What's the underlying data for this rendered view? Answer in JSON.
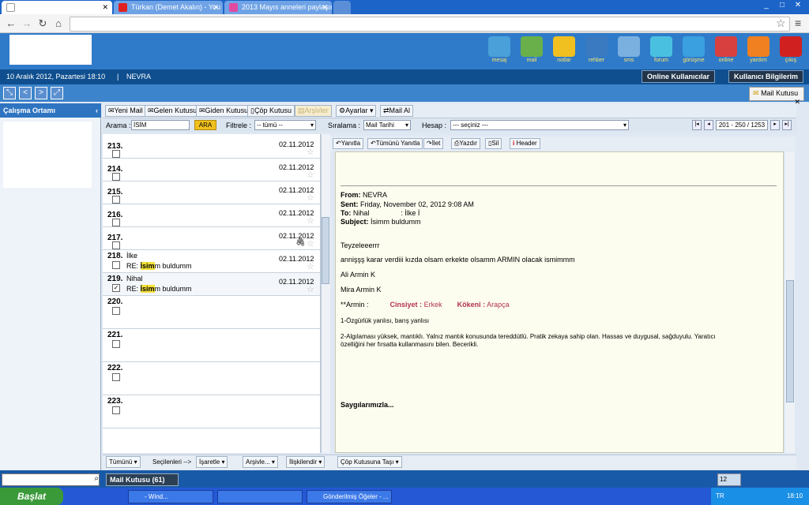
{
  "browser": {
    "tabs": [
      {
        "label": ""
      },
      {
        "label": "Türkan (Demet Akalın) - You"
      },
      {
        "label": "2013 Mayıs anneleri paylaşım"
      }
    ],
    "url": "",
    "window_controls": [
      "_",
      "□",
      "✕"
    ]
  },
  "app": {
    "icons": [
      {
        "label": "mesaj",
        "color": "#4aa0d8"
      },
      {
        "label": "mail",
        "color": "#6ab04a"
      },
      {
        "label": "notlar",
        "color": "#f0c020"
      },
      {
        "label": "rehber",
        "color": "#3a7ac0"
      },
      {
        "label": "sms",
        "color": "#7ab0e0"
      },
      {
        "label": "forum",
        "color": "#4ac0e0"
      },
      {
        "label": "görüşme",
        "color": "#3aa0e0"
      },
      {
        "label": "online",
        "color": "#d84040"
      },
      {
        "label": "yardım",
        "color": "#f08020"
      },
      {
        "label": "çıkış",
        "color": "#d02020"
      }
    ],
    "date": "10 Aralık 2012, Pazartesi 18:10",
    "user": "NEVRA",
    "online_users_btn": "Online Kullanıcılar",
    "user_info_btn": "Kullanıcı Bilgilerim",
    "mailbox_tab": "Mail Kutusu",
    "left_panel_title": "Çalışma Ortamı"
  },
  "mail_toolbar": {
    "new_mail": "Yeni Mail",
    "inbox": "Gelen Kutusu",
    "outbox": "Giden Kutusu",
    "trash": "Çöp Kutusu",
    "archive": "Arşivler",
    "settings": "Ayarlar",
    "fetch": "Mail Al"
  },
  "filters": {
    "search_label": "Arama :",
    "search_value": "İSİM",
    "search_btn": "ARA",
    "filter_label": "Filtrele :",
    "filter_value": "-- tümü --",
    "sort_label": "Sıralama :",
    "sort_value": "Mail Tarihi",
    "account_label": "Hesap :",
    "account_value": "--- seçiniz ---",
    "page_info": "201 - 250 / 1253"
  },
  "mails": [
    {
      "num": "213.",
      "date": "02.11.2012",
      "sender": "",
      "subject": "",
      "checked": false
    },
    {
      "num": "214.",
      "date": "02.11.2012",
      "sender": "",
      "subject": "",
      "checked": false
    },
    {
      "num": "215.",
      "date": "02.11.2012",
      "sender": "",
      "subject": "",
      "checked": false
    },
    {
      "num": "216.",
      "date": "02.11.2012",
      "sender": "",
      "subject": "",
      "checked": false
    },
    {
      "num": "217.",
      "date": "02.11.2012",
      "sender": "",
      "subject": "",
      "checked": false
    },
    {
      "num": "218.",
      "date": "02.11.2012",
      "sender": "İlke",
      "subject_pre": "RE: ",
      "subject_hl": "İsim",
      "subject_post": "m buldumm",
      "checked": false
    },
    {
      "num": "219.",
      "date": "02.11.2012",
      "sender": "Nihal",
      "subject_pre": "RE: ",
      "subject_hl": "İsim",
      "subject_post": "m buldumm",
      "checked": true
    },
    {
      "num": "220.",
      "date": "",
      "sender": "",
      "subject": "",
      "checked": false
    },
    {
      "num": "221.",
      "date": "",
      "sender": "",
      "subject": "",
      "checked": false
    },
    {
      "num": "222.",
      "date": "",
      "sender": "",
      "subject": "",
      "checked": false
    },
    {
      "num": "223.",
      "date": "",
      "sender": "",
      "subject": "",
      "checked": false
    }
  ],
  "read_toolbar": {
    "reply": "Yanıtla",
    "reply_all": "Tümünü Yanıtla",
    "forward": "İlet",
    "print": "Yazdır",
    "delete": "Sil",
    "header": "Header"
  },
  "message": {
    "from_label": "From:",
    "from": "NEVRA",
    "sent_label": "Sent:",
    "sent": "Friday, November 02, 2012 9:08 AM",
    "to_label": "To:",
    "to": "Nihal",
    "to_cc": ": İlke İ",
    "subject_label": "Subject:",
    "subject": "İsimm buldumm",
    "line1": "Teyzeleeerrr",
    "line2": "annişşş karar verdiii kızda olsam erkekte olsamm ARMIN olacak ismimmm",
    "line3": "Ali Armin K",
    "line4": "Mira Armin K",
    "armin_label": "**Armin :",
    "gender_label": "Cinsiyet :",
    "gender_value": "Erkek",
    "origin_label": "Kökeni :",
    "origin_value": "Arapça",
    "trait1": "1-Özgürlük yanlısı, barış yanlısı",
    "trait2a": "2-Algılaması yüksek, mantıklı. Yalnız mantık konusunda tereddütlü. Pratik zekaya sahip olan. Hassas ve duygusal, sağduyulu. Yaratıcı",
    "trait2b": "özelliğini her fırsatta kullanmasını bilen. Becerikli.",
    "closing": "Saygılarımızla..."
  },
  "bottom_bar": {
    "all": "Tümünü",
    "selected": "Seçilenleri -->",
    "mark": "İşaretle",
    "archive": "Arşivle...",
    "relate": "İlişkilendir",
    "move_trash": "Çöp Kutusuna Taşı"
  },
  "footer": {
    "mailbox": "Mail Kutusu (61)",
    "zoom": "12"
  },
  "taskbar": {
    "start": "Başlat",
    "items": [
      {
        "label": "- Wind..."
      },
      {
        "label": ""
      },
      {
        "label": "Gönderilmiş Öğeler - ..."
      }
    ],
    "lang": "TR",
    "clock": "18:10"
  }
}
